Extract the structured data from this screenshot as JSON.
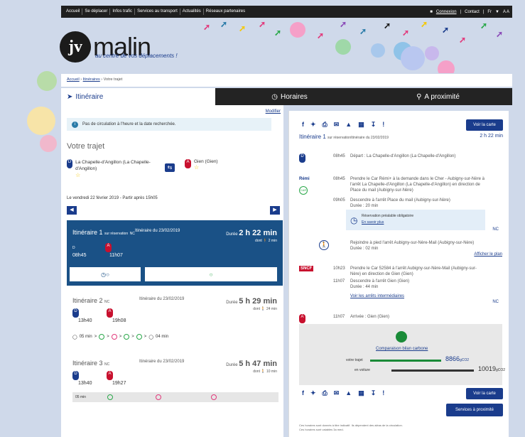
{
  "topbar": {
    "nav": [
      "Accueil",
      "Se déplacer",
      "Infos trafic",
      "Services au transport",
      "Actualités",
      "Réseaux partenaires"
    ],
    "connexion": "Connexion",
    "contact": "Contact",
    "lang": "Fr",
    "a11y": "A A"
  },
  "brand": {
    "logo_text": "jv",
    "name": "malin",
    "tagline": "au centre de vos déplacements !"
  },
  "breadcrumb": [
    "Accueil",
    "Itinéraires",
    "Votre trajet"
  ],
  "tabs": [
    "Itinéraire",
    "Horaires",
    "A proximité"
  ],
  "left": {
    "modifier": "Modifier",
    "alert": "Pas de circulation à l'heure et la date recherchée.",
    "section_title": "Votre trajet",
    "from": "La Chapelle-d'Angillon (La Chapelle-d'Angillon)",
    "to": "Gien (Gien)",
    "date_line": "Le vendredi 22 février 2019 - Partir après 15h05",
    "itin1": {
      "title": "Itinéraire 1",
      "tag": "sur réservation",
      "nc": "NC",
      "sub": "Itinéraire du 23/02/2019",
      "dur_label": "Durée",
      "dur": "2 h 22 min",
      "dont": "dont",
      "walk": "2 min",
      "dep": "08h45",
      "arr": "11h07",
      "d": "D"
    },
    "itin2": {
      "title": "Itinéraire 2",
      "nc": "NC",
      "sub": "Itinéraire du 23/02/2019",
      "dur_label": "Durée",
      "dur": "5 h 29 min",
      "dont": "dont",
      "walk": "24 min",
      "dep": "13h40",
      "arr": "19h08",
      "walk1": "05 min",
      "walk2": "04 min"
    },
    "itin3": {
      "title": "Itinéraire 3",
      "nc": "NC",
      "sub": "Itinéraire du 23/02/2019",
      "dur_label": "Durée",
      "dur": "5 h 47 min",
      "dont": "dont",
      "walk": "10 min",
      "dep": "13h40",
      "arr": "19h27",
      "walk1": "05 min"
    }
  },
  "right": {
    "voir_carte": "Voir la carte",
    "title": "Itinéraire 1",
    "tag": "sur réservation",
    "sub": "Itinéraire du 23/02/2019",
    "dur": "2 h 22 min",
    "steps": {
      "s1_time": "08h45",
      "s1_text": "Départ : La Chapelle-d'Angillon (La Chapelle-d'Angillon)",
      "s2_time": "08h45",
      "s2_text": "Prendre le Car Rémi+ à la demande dans le Cher - Aubigny-sur-Nère à l'arrêt La Chapelle-d'Angillon (La Chapelle-d'Angillon) en direction de Place du mail (Aubigny-sur-Nère)",
      "s3_time": "09h05",
      "s3_text": "Descendre à l'arrêt Place du mail (Aubigny-sur-Nère)",
      "s3_dur": "Durée : 20 min",
      "resa": "Réservation préalable obligatoire",
      "resa_link": "En savoir plus",
      "walk_text": "Rejoindre à pied l'arrêt Aubigny-sur-Nère-Mail (Aubigny-sur-Nère)",
      "walk_dur": "Durée : 02 min",
      "show_plan": "Afficher le plan",
      "s4_time": "10h23",
      "s4_text": "Prendre le Car 52584 à l'arrêt Aubigny-sur-Nère-Mail (Aubigny-sur-Nère) en direction de Gien (Gien)",
      "s5_time": "11h07",
      "s5_text": "Descendre à l'arrêt Gien (Gien)",
      "s5_dur": "Durée : 44 min",
      "see_stops": "Voir les arrêts intermédiaires",
      "s6_time": "11h07",
      "s6_text": "Arrivée : Gien (Gien)",
      "nc": "NC",
      "car": "CAR",
      "sncf": "SNCF",
      "remi": "Rémi"
    },
    "carbon": {
      "link": "Comparaison bilan carbone",
      "your_trip": "votre trajet",
      "car": "en voiture",
      "v1": "8866",
      "v2": "10019",
      "unit": "gCO2"
    },
    "services": "Services à proximité",
    "foot1": "Ces horaires sont donnés à titre indicatif. Ils dépendent des aléas de la circulation.",
    "foot2": "Ces horaires sont valables 3a med."
  }
}
